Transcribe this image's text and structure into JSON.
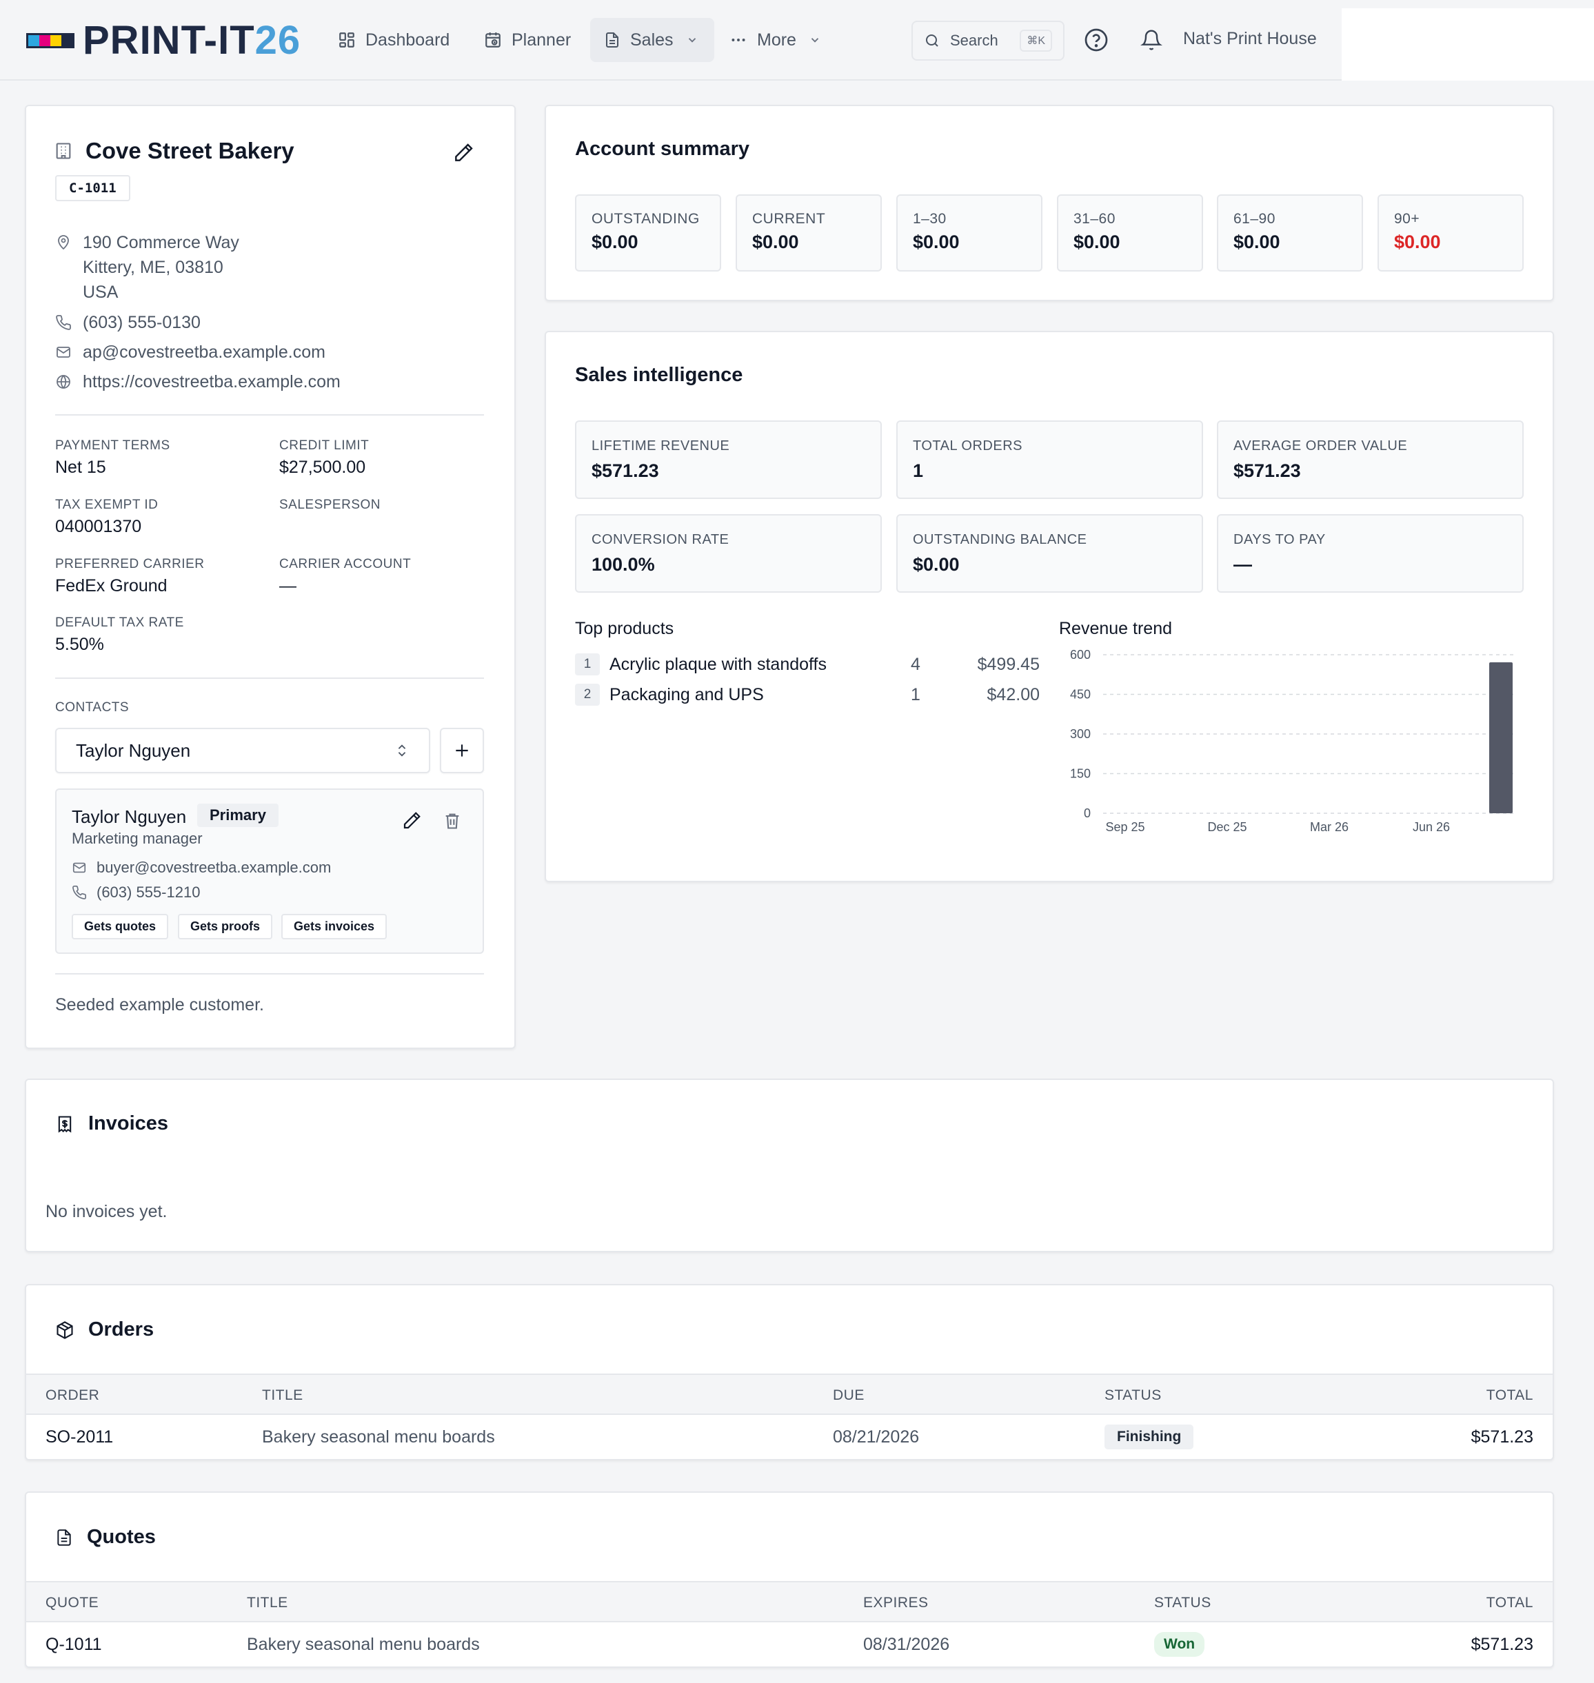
{
  "app": {
    "brand_main": "PRINT-IT",
    "brand_num": "26",
    "logo_colors": [
      "#2ea7e0",
      "#e6007e",
      "#ffd200",
      "#1f2a44"
    ]
  },
  "nav": {
    "dashboard": "Dashboard",
    "planner": "Planner",
    "sales": "Sales",
    "more": "More",
    "search_label": "Search",
    "search_shortcut": "⌘K",
    "shop_name": "Nat's Print House"
  },
  "customer": {
    "name": "Cove Street Bakery",
    "code": "C-1011",
    "address_line1": "190 Commerce Way",
    "address_line2": "Kittery, ME, 03810",
    "address_line3": "USA",
    "phone": "(603) 555-0130",
    "email": "ap@covestreetba.example.com",
    "website": "https://covestreetba.example.com",
    "fields": {
      "payment_terms_label": "PAYMENT TERMS",
      "payment_terms": "Net 15",
      "credit_limit_label": "CREDIT LIMIT",
      "credit_limit": "$27,500.00",
      "tax_exempt_label": "TAX EXEMPT ID",
      "tax_exempt": "040001370",
      "salesperson_label": "SALESPERSON",
      "salesperson": "",
      "carrier_label": "PREFERRED CARRIER",
      "carrier": "FedEx Ground",
      "carrier_account_label": "CARRIER ACCOUNT",
      "carrier_account": "—",
      "tax_rate_label": "DEFAULT TAX RATE",
      "tax_rate": "5.50%"
    },
    "contacts_label": "CONTACTS",
    "selected_contact": "Taylor Nguyen",
    "contact": {
      "name": "Taylor Nguyen",
      "badge": "Primary",
      "role": "Marketing manager",
      "email": "buyer@covestreetba.example.com",
      "phone": "(603) 555-1210",
      "tags": [
        "Gets quotes",
        "Gets proofs",
        "Gets invoices"
      ]
    },
    "notes": "Seeded example customer."
  },
  "account_summary": {
    "title": "Account summary",
    "buckets": [
      {
        "label": "OUTSTANDING",
        "value": "$0.00"
      },
      {
        "label": "CURRENT",
        "value": "$0.00"
      },
      {
        "label": "1–30",
        "value": "$0.00"
      },
      {
        "label": "31–60",
        "value": "$0.00"
      },
      {
        "label": "61–90",
        "value": "$0.00"
      },
      {
        "label": "90+",
        "value": "$0.00"
      }
    ],
    "overdue_color": "#dc2626"
  },
  "sales_intel": {
    "title": "Sales intelligence",
    "stats": [
      {
        "label": "LIFETIME REVENUE",
        "value": "$571.23"
      },
      {
        "label": "TOTAL ORDERS",
        "value": "1"
      },
      {
        "label": "AVERAGE ORDER VALUE",
        "value": "$571.23"
      },
      {
        "label": "CONVERSION RATE",
        "value": "100.0%"
      },
      {
        "label": "OUTSTANDING BALANCE",
        "value": "$0.00"
      },
      {
        "label": "DAYS TO PAY",
        "value": "—"
      }
    ],
    "top_products_title": "Top products",
    "top_products": [
      {
        "rank": "1",
        "name": "Acrylic plaque with standoffs",
        "qty": "4",
        "amount": "$499.45"
      },
      {
        "rank": "2",
        "name": "Packaging and UPS",
        "qty": "1",
        "amount": "$42.00"
      }
    ],
    "revenue_trend_title": "Revenue trend"
  },
  "chart_data": {
    "type": "bar",
    "x_ticks": [
      "Sep 25",
      "Dec 25",
      "Mar 26",
      "Jun 26"
    ],
    "y_ticks": [
      0,
      150,
      300,
      450,
      600
    ],
    "ylim": [
      0,
      600
    ],
    "grid": true,
    "bar_color": "#545866",
    "series": [
      {
        "values": [
          {
            "x": "Aug 26",
            "y": 571.23
          }
        ]
      }
    ]
  },
  "invoices": {
    "title": "Invoices",
    "empty_text": "No invoices yet."
  },
  "orders": {
    "title": "Orders",
    "columns": [
      "ORDER",
      "TITLE",
      "DUE",
      "STATUS",
      "TOTAL"
    ],
    "rows": [
      {
        "id": "SO-2011",
        "title": "Bakery seasonal menu boards",
        "date": "08/21/2026",
        "status": "Finishing",
        "total": "$571.23"
      }
    ]
  },
  "quotes": {
    "title": "Quotes",
    "columns": [
      "QUOTE",
      "TITLE",
      "EXPIRES",
      "STATUS",
      "TOTAL"
    ],
    "rows": [
      {
        "id": "Q-1011",
        "title": "Bakery seasonal menu boards",
        "date": "08/31/2026",
        "status": "Won",
        "total": "$571.23"
      }
    ]
  }
}
